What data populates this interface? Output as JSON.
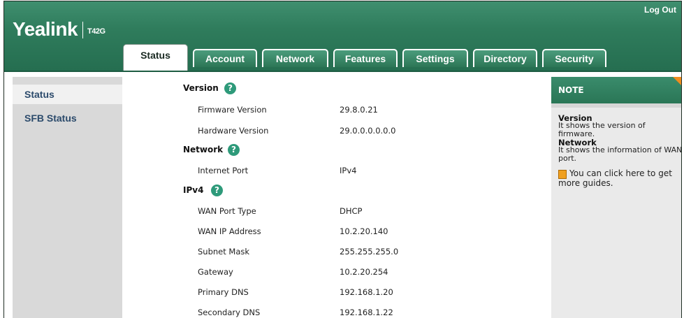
{
  "header": {
    "logo": "Yealink",
    "model": "T42G",
    "logout_label": "Log Out",
    "brand_color": "#2f7c5c"
  },
  "tabs": [
    {
      "label": "Status",
      "active": true
    },
    {
      "label": "Account",
      "active": false
    },
    {
      "label": "Network",
      "active": false
    },
    {
      "label": "Features",
      "active": false
    },
    {
      "label": "Settings",
      "active": false
    },
    {
      "label": "Directory",
      "active": false
    },
    {
      "label": "Security",
      "active": false
    }
  ],
  "sidebar": {
    "items": [
      {
        "label": "Status",
        "active": true
      },
      {
        "label": "SFB Status",
        "active": false
      }
    ]
  },
  "sections": {
    "version": {
      "title": "Version",
      "rows": [
        {
          "label": "Firmware Version",
          "value": "29.8.0.21"
        },
        {
          "label": "Hardware Version",
          "value": "29.0.0.0.0.0.0"
        }
      ]
    },
    "network": {
      "title": "Network",
      "rows": [
        {
          "label": "Internet Port",
          "value": "IPv4"
        }
      ]
    },
    "ipv4": {
      "title": "IPv4",
      "rows": [
        {
          "label": "WAN Port Type",
          "value": "DHCP"
        },
        {
          "label": "WAN IP Address",
          "value": "10.2.20.140"
        },
        {
          "label": "Subnet Mask",
          "value": "255.255.255.0"
        },
        {
          "label": "Gateway",
          "value": "10.2.20.254"
        },
        {
          "label": "Primary DNS",
          "value": "192.168.1.20"
        },
        {
          "label": "Secondary DNS",
          "value": "192.168.1.22"
        }
      ]
    },
    "help_glyph": "?"
  },
  "note": {
    "title": "NOTE",
    "items": [
      {
        "heading": "Version",
        "text": "It shows the version of firmware."
      },
      {
        "heading": "Network",
        "text": "It shows the information of WAN port."
      }
    ],
    "guide_text": "You can click here to get more guides."
  }
}
